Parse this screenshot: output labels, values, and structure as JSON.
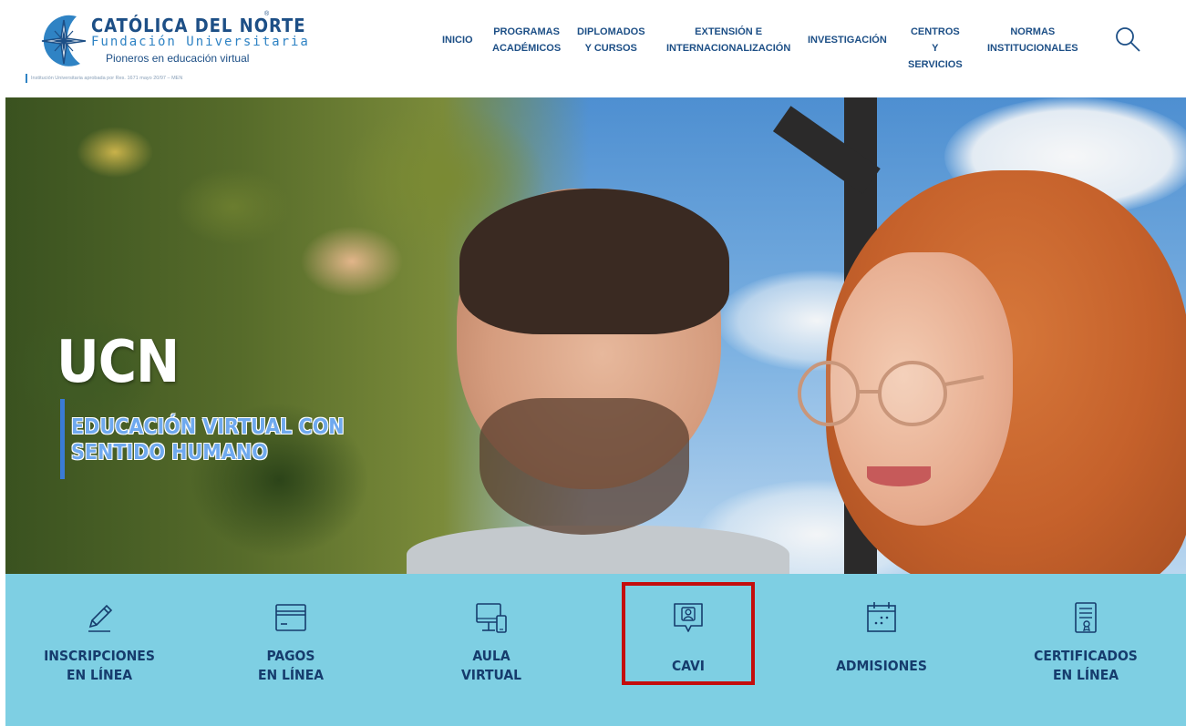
{
  "brand": {
    "title": "CATÓLICA DEL NORTE",
    "registered": "®",
    "subtitle": "Fundación Universitaria",
    "tagline": "Pioneros en educación virtual",
    "accreditation": "Institución Universitaria aprobada por Res. 1671 mayo 20/97 – MEN"
  },
  "nav": {
    "items": [
      {
        "id": "inicio",
        "label": "INICIO"
      },
      {
        "id": "programas",
        "label": "PROGRAMAS\nACADÉMICOS"
      },
      {
        "id": "diplomados",
        "label": "DIPLOMADOS\nY CURSOS"
      },
      {
        "id": "extension",
        "label": "EXTENSIÓN E\nINTERNACIONALIZACIÓN"
      },
      {
        "id": "investigacion",
        "label": "INVESTIGACIÓN"
      },
      {
        "id": "centros",
        "label": "CENTROS\nY SERVICIOS"
      },
      {
        "id": "normas",
        "label": "NORMAS\nINSTITUCIONALES"
      }
    ],
    "search_icon": "search-icon"
  },
  "hero": {
    "headline": "UCN",
    "tagline": "EDUCACIÓN VIRTUAL CON\nSENTIDO HUMANO"
  },
  "quick_links": [
    {
      "id": "inscripciones",
      "label": "INSCRIPCIONES\nEN LÍNEA",
      "icon": "pencil-icon"
    },
    {
      "id": "pagos",
      "label": "PAGOS\nEN LÍNEA",
      "icon": "credit-card-icon"
    },
    {
      "id": "aula",
      "label": "AULA\nVIRTUAL",
      "icon": "devices-icon"
    },
    {
      "id": "cavi",
      "label": "CAVI",
      "icon": "chat-user-icon",
      "highlighted": true
    },
    {
      "id": "admisiones",
      "label": "ADMISIONES",
      "icon": "calendar-icon"
    },
    {
      "id": "certificados",
      "label": "CERTIFICADOS\nEN LÍNEA",
      "icon": "certificate-icon"
    }
  ],
  "colors": {
    "brand_blue": "#1d4f86",
    "accent_blue": "#2f83c4",
    "quick_bar": "#7ecfe3",
    "quick_text": "#163c6d",
    "highlight": "#c40d0d",
    "tagline_blue": "#6fa9ee"
  }
}
